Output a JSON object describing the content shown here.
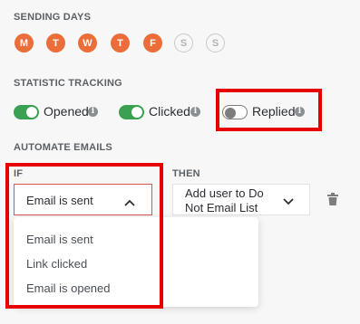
{
  "sending_days": {
    "label": "SENDING DAYS",
    "days": [
      {
        "letter": "M",
        "active": true
      },
      {
        "letter": "T",
        "active": true
      },
      {
        "letter": "W",
        "active": true
      },
      {
        "letter": "T",
        "active": true
      },
      {
        "letter": "F",
        "active": true
      },
      {
        "letter": "S",
        "active": false
      },
      {
        "letter": "S",
        "active": false
      }
    ]
  },
  "statistic_tracking": {
    "label": "STATISTIC TRACKING",
    "toggles": [
      {
        "label": "Opened",
        "on": true
      },
      {
        "label": "Clicked",
        "on": true
      },
      {
        "label": "Replied",
        "on": false
      }
    ]
  },
  "automate_emails": {
    "label": "AUTOMATE EMAILS",
    "if_label": "IF",
    "then_label": "THEN",
    "if_selected": "Email is sent",
    "then_selected": "Add user to Do Not Email List",
    "then_line1": "Add user to Do",
    "then_line2": "Not Email List",
    "options": [
      "Email is sent",
      "Link clicked",
      "Email is opened"
    ]
  },
  "colors": {
    "day_active": "#ea6d3a",
    "toggle_on": "#3aa153",
    "highlight": "#e60000"
  },
  "icons": {
    "info": "info-icon",
    "chevron_up": "chevron-up-icon",
    "chevron_down": "chevron-down-icon",
    "trash": "trash-icon"
  }
}
